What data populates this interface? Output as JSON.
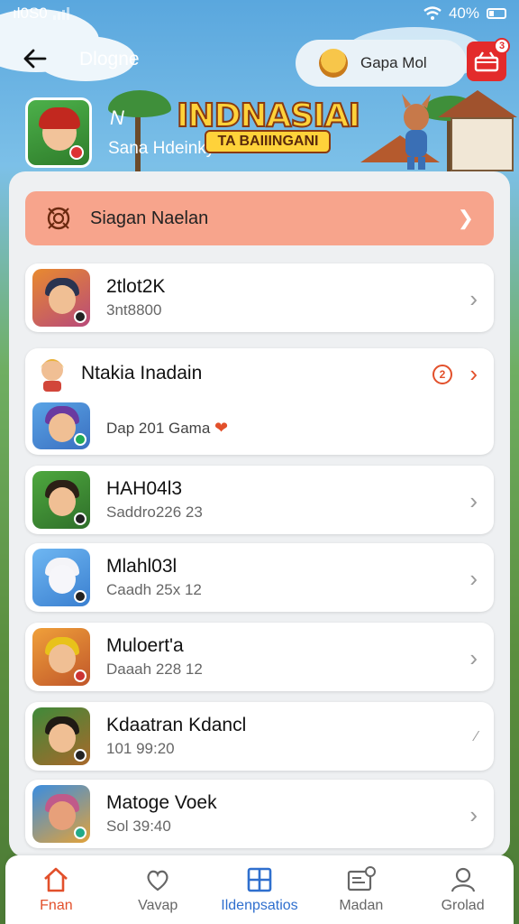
{
  "status_bar": {
    "left_text": "ıl0S0",
    "battery": "40%",
    "wifi_icon": "wifi-icon",
    "battery_icon": "battery-icon"
  },
  "header": {
    "title": "Dlogne",
    "back_icon": "back-arrow-icon",
    "game_pill_label": "Gapa Mol",
    "cart_icon": "cart-icon",
    "cart_badge": "3"
  },
  "hero": {
    "letter": "N",
    "subtitle": "Sana Hdeinky",
    "logo_main": "INDNASIAI",
    "logo_band": "TA BAIIINGANI"
  },
  "promo": {
    "label": "Siagan Naelan",
    "icon": "target-icon",
    "color": "#f7a48c"
  },
  "list": [
    {
      "title": "2tlot2K",
      "subtitle": "3nt8800"
    },
    {
      "title": "Ntakia Inadain",
      "subtitle": "Dap 201 Gama",
      "alert_badge": "2"
    },
    {
      "title": "HAH04l3",
      "subtitle": "Saddro226 23"
    },
    {
      "title": "Mlahl03l",
      "subtitle": "Caadh 25x 12"
    },
    {
      "title": "Muloert'a",
      "subtitle": "Daaah 228 12"
    },
    {
      "title": "Kdaatran Kdancl",
      "subtitle": "101 99:20"
    },
    {
      "title": "Matoge Voek",
      "subtitle": "Sol 39:40"
    }
  ],
  "bottom_nav": [
    {
      "label": "Fnan",
      "icon": "home-icon",
      "state": "active-red"
    },
    {
      "label": "Vavap",
      "icon": "heart-icon",
      "state": ""
    },
    {
      "label": "Ildenpsatios",
      "icon": "grid-icon",
      "state": "active-blue"
    },
    {
      "label": "Madan",
      "icon": "mail-icon",
      "state": ""
    },
    {
      "label": "Grolad",
      "icon": "profile-icon",
      "state": ""
    }
  ],
  "colors": {
    "accent_red": "#e2502b",
    "accent_blue": "#2f6fce",
    "cart_red": "#e32b2b"
  }
}
